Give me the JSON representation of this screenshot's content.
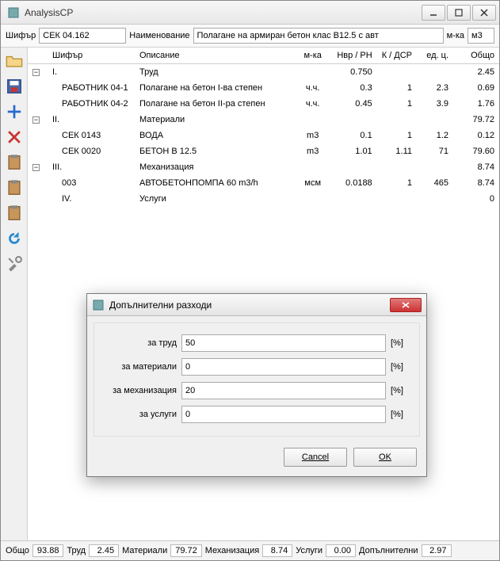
{
  "window": {
    "title": "AnalysisCP"
  },
  "top": {
    "code_label": "Шифър",
    "code_value": "СЕК 04.162",
    "name_label": "Наименование",
    "name_value": "Полагане на армиран бетон клас B12.5 с авт",
    "unit_label": "м-ка",
    "unit_value": "м3"
  },
  "columns": {
    "code": "Шифър",
    "desc": "Описание",
    "unit": "м-ка",
    "nvr": "Нвр / РН",
    "k": "К / ДСР",
    "price": "ед. ц.",
    "total": "Общо"
  },
  "rows": [
    {
      "exp": "−",
      "code": "I.",
      "desc": "Труд",
      "unit": "",
      "nvr": "0.750",
      "k": "",
      "price": "",
      "total": "2.45"
    },
    {
      "exp": "",
      "code": "РАБОТНИК 04-1",
      "desc": "Полагане на бетон I-ва степен",
      "unit": "ч.ч.",
      "nvr": "0.3",
      "k": "1",
      "price": "2.3",
      "total": "0.69"
    },
    {
      "exp": "",
      "code": "РАБОТНИК 04-2",
      "desc": "Полагане на бетон II-ра степен",
      "unit": "ч.ч.",
      "nvr": "0.45",
      "k": "1",
      "price": "3.9",
      "total": "1.76"
    },
    {
      "exp": "−",
      "code": "II.",
      "desc": "Материали",
      "unit": "",
      "nvr": "",
      "k": "",
      "price": "",
      "total": "79.72"
    },
    {
      "exp": "",
      "code": "СЕК 0143",
      "desc": "ВОДА",
      "unit": "m3",
      "nvr": "0.1",
      "k": "1",
      "price": "1.2",
      "total": "0.12"
    },
    {
      "exp": "",
      "code": "СЕК 0020",
      "desc": "БЕТОН B 12.5",
      "unit": "m3",
      "nvr": "1.01",
      "k": "1.11",
      "price": "71",
      "total": "79.60"
    },
    {
      "exp": "−",
      "code": "III.",
      "desc": "Механизация",
      "unit": "",
      "nvr": "",
      "k": "",
      "price": "",
      "total": "8.74"
    },
    {
      "exp": "",
      "code": "003",
      "desc": "АВТОБЕТОНПОМПА 60 m3/h",
      "unit": "мсм",
      "nvr": "0.0188",
      "k": "1",
      "price": "465",
      "total": "8.74"
    },
    {
      "exp": "",
      "code": "IV.",
      "desc": "Услуги",
      "unit": "",
      "nvr": "",
      "k": "",
      "price": "",
      "total": "0"
    }
  ],
  "status": {
    "total_label": "Общо",
    "total": "93.88",
    "labor_label": "Труд",
    "labor": "2.45",
    "materials_label": "Материали",
    "materials": "79.72",
    "mech_label": "Механизация",
    "mech": "8.74",
    "services_label": "Услуги",
    "services": "0.00",
    "extra_label": "Допълнителни",
    "extra": "2.97"
  },
  "dialog": {
    "title": "Допълнителни разходи",
    "labor_label": "за труд",
    "labor_value": "50",
    "materials_label": "за материали",
    "materials_value": "0",
    "mech_label": "за механизация",
    "mech_value": "20",
    "services_label": "за услуги",
    "services_value": "0",
    "unit": "[%]",
    "cancel": "Cancel",
    "ok": "OK"
  },
  "icons": {
    "folder": "folder-open-icon",
    "save": "save-icon",
    "add": "plus-icon",
    "delete": "x-icon",
    "clip1": "clipboard-icon",
    "clip2": "clipboard-icon",
    "clip3": "clipboard-icon",
    "refresh": "refresh-icon",
    "tools": "tools-icon"
  }
}
